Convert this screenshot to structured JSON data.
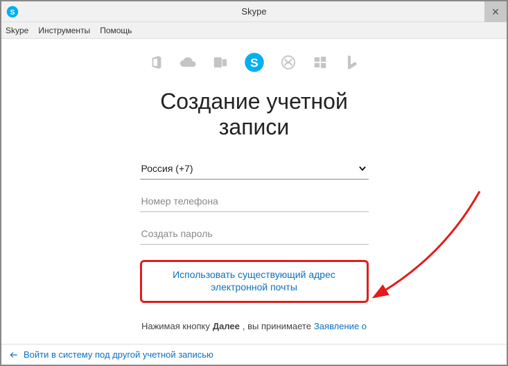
{
  "titlebar": {
    "title": "Skype"
  },
  "menubar": {
    "items": [
      "Skype",
      "Инструменты",
      "Помощь"
    ]
  },
  "brands": [
    "office",
    "onedrive",
    "outlook",
    "skype",
    "xbox",
    "windows",
    "bing"
  ],
  "heading": {
    "line1": "Создание учетной",
    "line2": "записи"
  },
  "form": {
    "country": "Россия (+7)",
    "phone_placeholder": "Номер телефона",
    "password_placeholder": "Создать пароль"
  },
  "emailLink": {
    "line1": "Использовать существующий адрес",
    "line2": "электронной почты"
  },
  "disclaimer": {
    "pre": "Нажимая кнопку",
    "bold": "Далее",
    "post": ", вы принимаете",
    "link": "Заявление о"
  },
  "footer": {
    "text": "Войти в систему под другой учетной записью"
  }
}
